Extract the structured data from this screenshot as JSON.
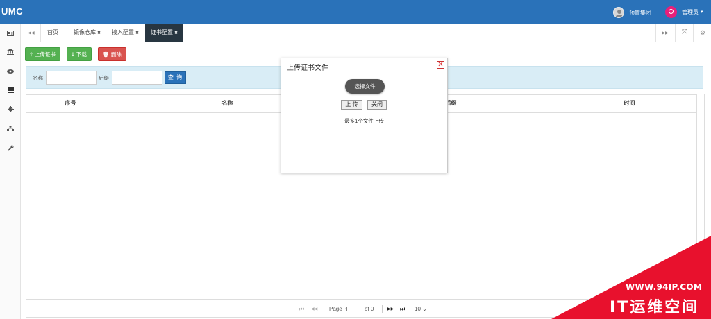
{
  "app": {
    "logo": "UMC"
  },
  "header": {
    "org_name": "预置集团",
    "user_name": "管理员",
    "caret": "▾"
  },
  "sidebar": {
    "icons": [
      "id-card-icon",
      "bank-icon",
      "eye-icon",
      "list-icon",
      "gear-icon",
      "sitemap-icon",
      "wrench-icon"
    ]
  },
  "tabs": {
    "prev": "◀◀",
    "items": [
      {
        "label": "首页"
      },
      {
        "label": "镜像仓库",
        "close": "✖"
      },
      {
        "label": "接入配置",
        "close": "✖"
      },
      {
        "label": "证书配置",
        "close": "✖"
      }
    ],
    "next": "▶▶",
    "fullscreen": "⤧",
    "settings": "⚙"
  },
  "toolbar": {
    "upload_icon": "🡑",
    "upload_label": "上传证书",
    "download_icon": "🡓",
    "download_label": "下载",
    "delete_icon": "🗑",
    "delete_label": "删除"
  },
  "search": {
    "name_label": "名称",
    "name_value": "",
    "suffix_label": "后缀",
    "suffix_value": "",
    "query_label": "查 询"
  },
  "table": {
    "columns": [
      "序号",
      "名称",
      "后缀",
      "时间"
    ]
  },
  "pager": {
    "first": "⏮",
    "prev": "◀◀",
    "page_label": "Page",
    "page_value": "1",
    "of_label": "of 0",
    "next": "▶▶",
    "last": "⏭",
    "page_size": "10",
    "size_caret": "⌄"
  },
  "modal": {
    "title": "上传证书文件",
    "close": "✕",
    "choose_label": "选择文件",
    "upload_label": "上 传",
    "close_label": "关闭",
    "note": "最多1个文件上传"
  },
  "watermark": {
    "url": "WWW.94IP.COM",
    "text": "IT运维空间",
    "color": "#e8112d"
  }
}
